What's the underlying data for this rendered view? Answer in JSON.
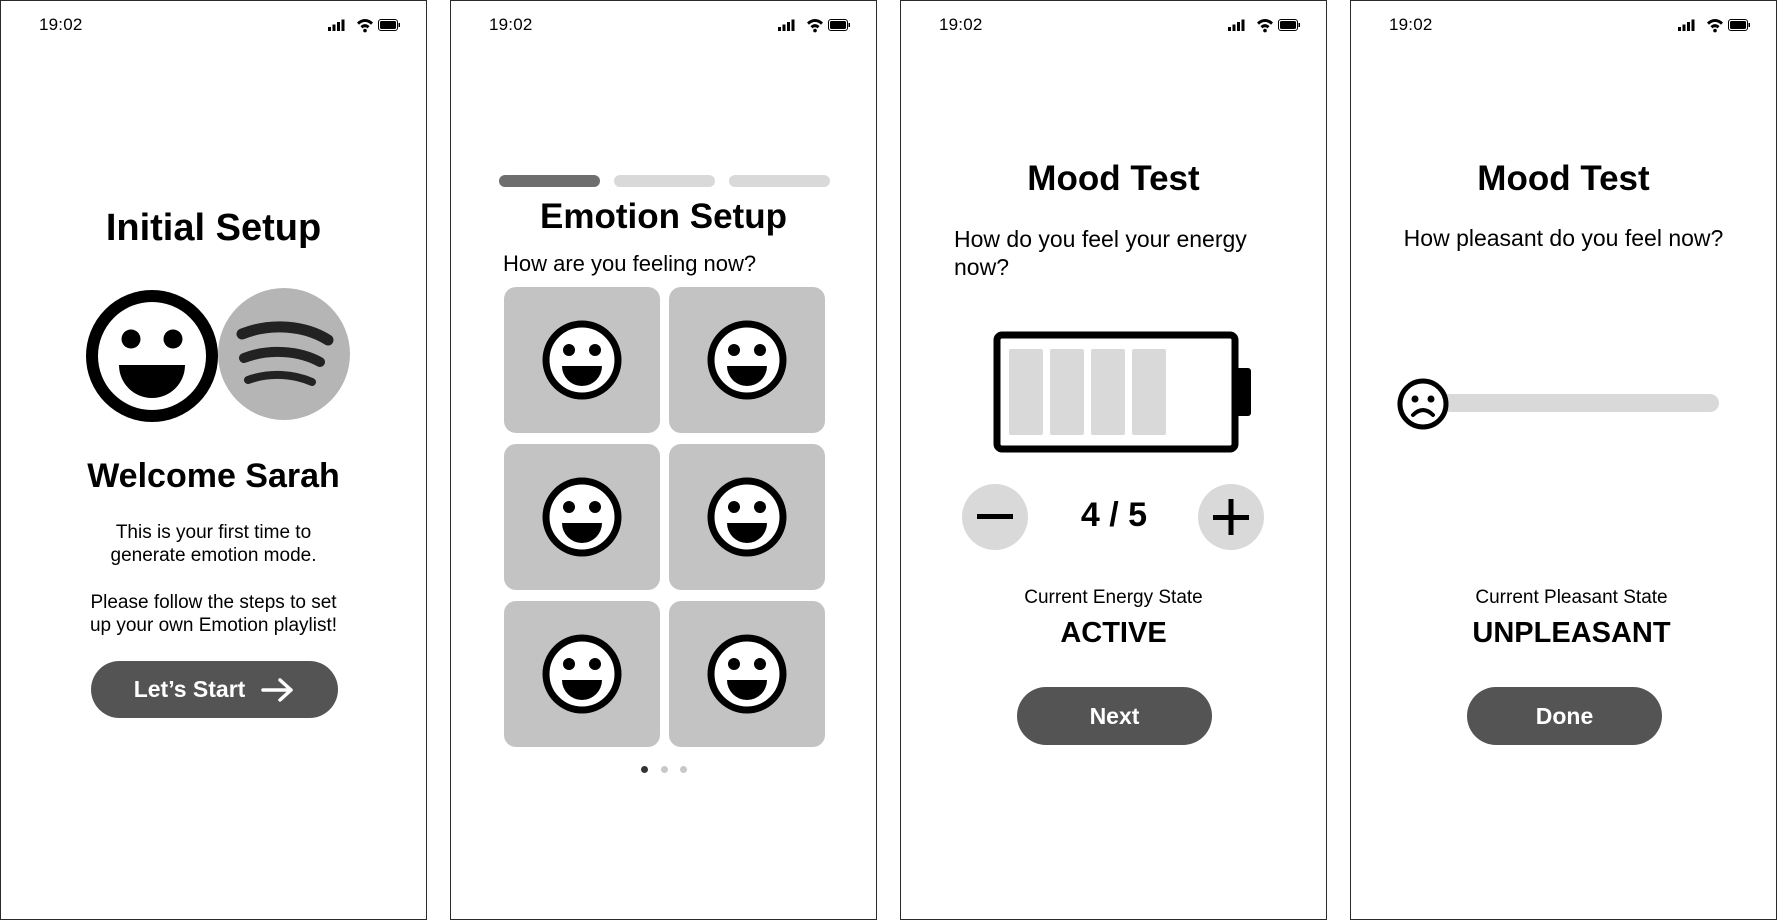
{
  "status_bar": {
    "time": "19:02"
  },
  "screen1": {
    "title": "Initial Setup",
    "welcome": "Welcome Sarah",
    "desc_line1": "This is your first time to",
    "desc_line2": "generate emotion mode.",
    "desc_line3": "Please follow the steps to set",
    "desc_line4": "up your own Emotion playlist!",
    "start_button": "Let’s Start"
  },
  "screen2": {
    "title": "Emotion Setup",
    "question": "How are you feeling now?",
    "progress": {
      "current_step": 1,
      "total_steps": 3
    },
    "emotion_tiles": [
      "happy-face-icon",
      "happy-face-icon",
      "happy-face-icon",
      "happy-face-icon",
      "happy-face-icon",
      "happy-face-icon"
    ],
    "page_indicator": {
      "current": 1,
      "total": 3
    }
  },
  "screen3": {
    "title": "Mood Test",
    "question_line1": "How do you feel your energy",
    "question_line2": "now?",
    "energy_value": "4 / 5",
    "energy_level": 4,
    "energy_max": 5,
    "state_label": "Current Energy State",
    "state_value": "ACTIVE",
    "next_button": "Next"
  },
  "screen4": {
    "title": "Mood Test",
    "question": "How pleasant do you feel now?",
    "slider_value": 0,
    "state_label": "Current Pleasant State",
    "state_value": "UNPLEASANT",
    "done_button": "Done"
  },
  "colors": {
    "button": "#545454",
    "tile": "#c3c3c3",
    "light_gray": "#d9d9d9",
    "progress_active": "#6e6e6e"
  }
}
